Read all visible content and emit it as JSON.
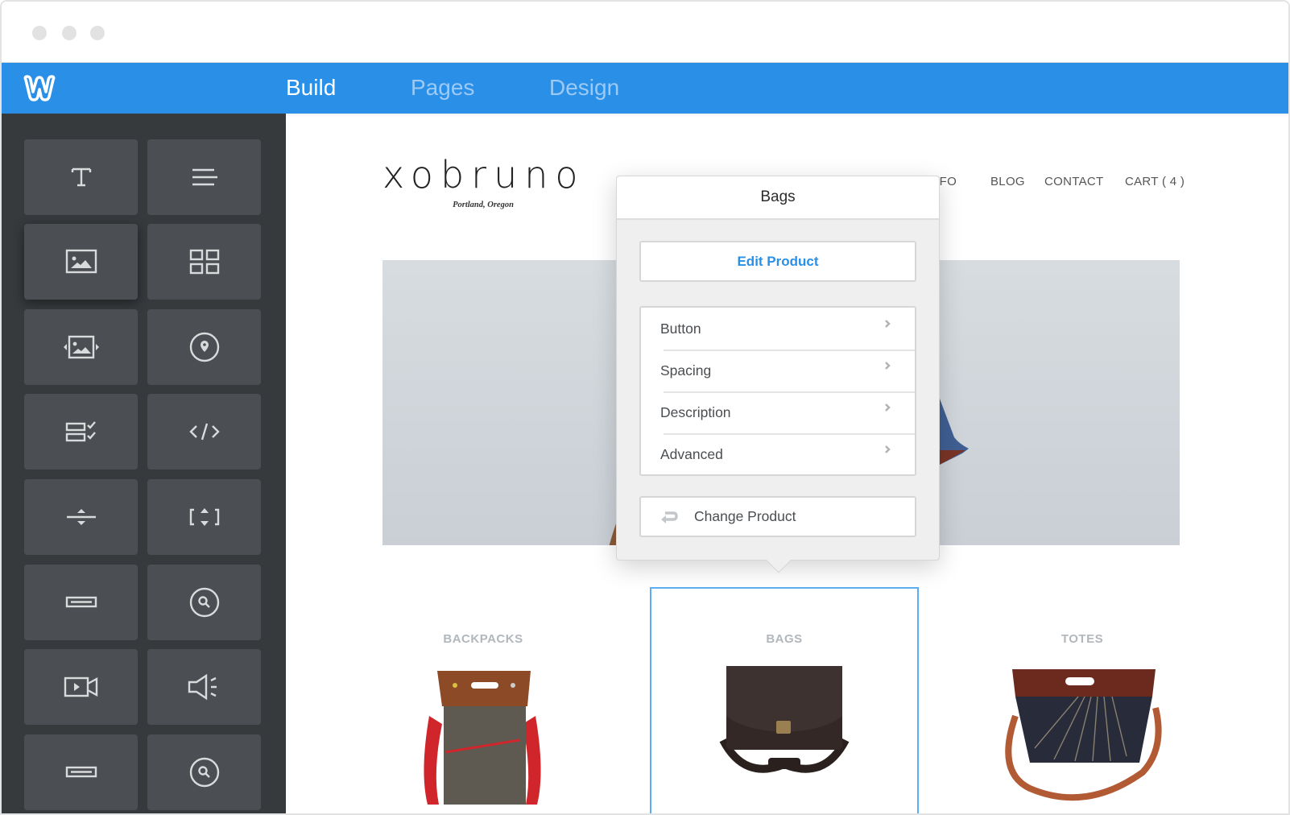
{
  "window": {
    "traffic_lights": [
      "close",
      "minimize",
      "zoom"
    ]
  },
  "appbar": {
    "logo": "weebly-w-logo",
    "tabs": [
      {
        "label": "Build",
        "active": true
      },
      {
        "label": "Pages",
        "active": false
      },
      {
        "label": "Design",
        "active": false
      }
    ],
    "colors": {
      "bar": "#2a8fe7",
      "active_tab": "#ffffff",
      "inactive_tab": "#9ccaf5"
    }
  },
  "sidebar": {
    "tiles": [
      {
        "icon": "text-icon"
      },
      {
        "icon": "paragraph-icon"
      },
      {
        "icon": "image-icon",
        "state": "dragging"
      },
      {
        "icon": "gallery-icon"
      },
      {
        "icon": "slideshow-icon"
      },
      {
        "icon": "map-pin-icon"
      },
      {
        "icon": "form-icon"
      },
      {
        "icon": "embed-code-icon"
      },
      {
        "icon": "divider-icon"
      },
      {
        "icon": "spacer-icon"
      },
      {
        "icon": "button-icon"
      },
      {
        "icon": "search-icon"
      },
      {
        "icon": "video-icon"
      },
      {
        "icon": "audio-icon"
      },
      {
        "icon": "button-icon"
      },
      {
        "icon": "search-icon"
      }
    ]
  },
  "site": {
    "logo": {
      "wordmark": "xobruno",
      "tagline": "Portland, Oregon"
    },
    "nav": [
      "INFO",
      "BLOG",
      "CONTACT",
      "CART ( 4 )"
    ],
    "categories": [
      {
        "title": "BACKPACKS",
        "selected": false
      },
      {
        "title": "BAGS",
        "selected": true
      },
      {
        "title": "TOTES",
        "selected": false
      }
    ]
  },
  "popover": {
    "title": "Bags",
    "primary_action": "Edit Product",
    "menu": [
      "Button",
      "Spacing",
      "Description",
      "Advanced"
    ],
    "secondary_action": "Change Product",
    "accent": "#2a8fe7"
  }
}
